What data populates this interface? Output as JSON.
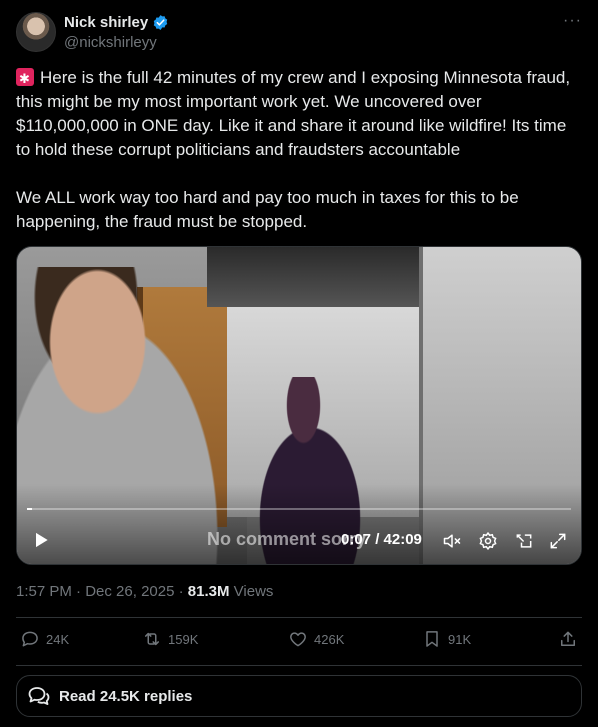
{
  "user": {
    "name": "Nick shirley",
    "handle": "@nickshirleyy"
  },
  "more_label": "···",
  "tweet": {
    "paragraph1": "Here is the full 42 minutes of my crew and I exposing Minnesota fraud, this might be my most important work yet. We uncovered over $110,000,000 in ONE day. Like it and share it around like wildfire! Its time to hold these corrupt politicians and fraudsters accountable",
    "paragraph2": "We ALL work way too hard and pay too much in taxes for this to be happening, the fraud must be stopped."
  },
  "video": {
    "caption": "No comment sorry",
    "current_time": "0:07",
    "duration": "42:09",
    "timecode": "0:07 / 42:09",
    "progress": 0.003
  },
  "meta": {
    "time": "1:57 PM",
    "date": "Dec 26, 2025",
    "views_count": "81.3M",
    "views_label": "Views"
  },
  "actions": {
    "replies": "24K",
    "reposts": "159K",
    "likes": "426K",
    "bookmarks": "91K"
  },
  "read_replies": "Read 24.5K replies",
  "colors": {
    "background": "#000000",
    "text": "#e7e9ea",
    "muted": "#71767b",
    "verified": "#1d9bf0",
    "border": "#2f3336"
  }
}
